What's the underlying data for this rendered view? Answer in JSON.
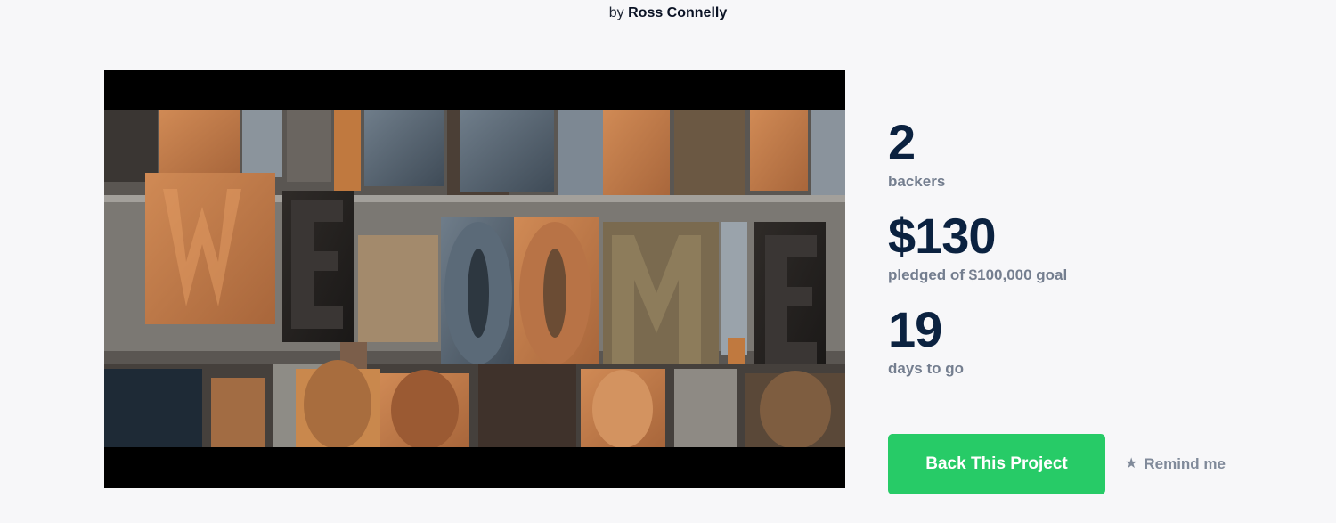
{
  "byline": {
    "prefix": "by",
    "author": "Ross Connelly"
  },
  "video": {
    "alt": "Letterpress wood type spelling WELCOME",
    "pictured_text": "WE COME"
  },
  "stats": {
    "backers": {
      "value": "2",
      "label": "backers"
    },
    "pledged": {
      "value": "$130",
      "label": "pledged of $100,000 goal"
    },
    "days": {
      "value": "19",
      "label": "days to go"
    }
  },
  "actions": {
    "back_label": "Back This Project",
    "remind_label": "Remind me",
    "remind_icon": "star-icon"
  },
  "colors": {
    "accent": "#27cb67",
    "heading": "#0b2240",
    "muted": "#747e8f",
    "background": "#f7f7f9"
  }
}
